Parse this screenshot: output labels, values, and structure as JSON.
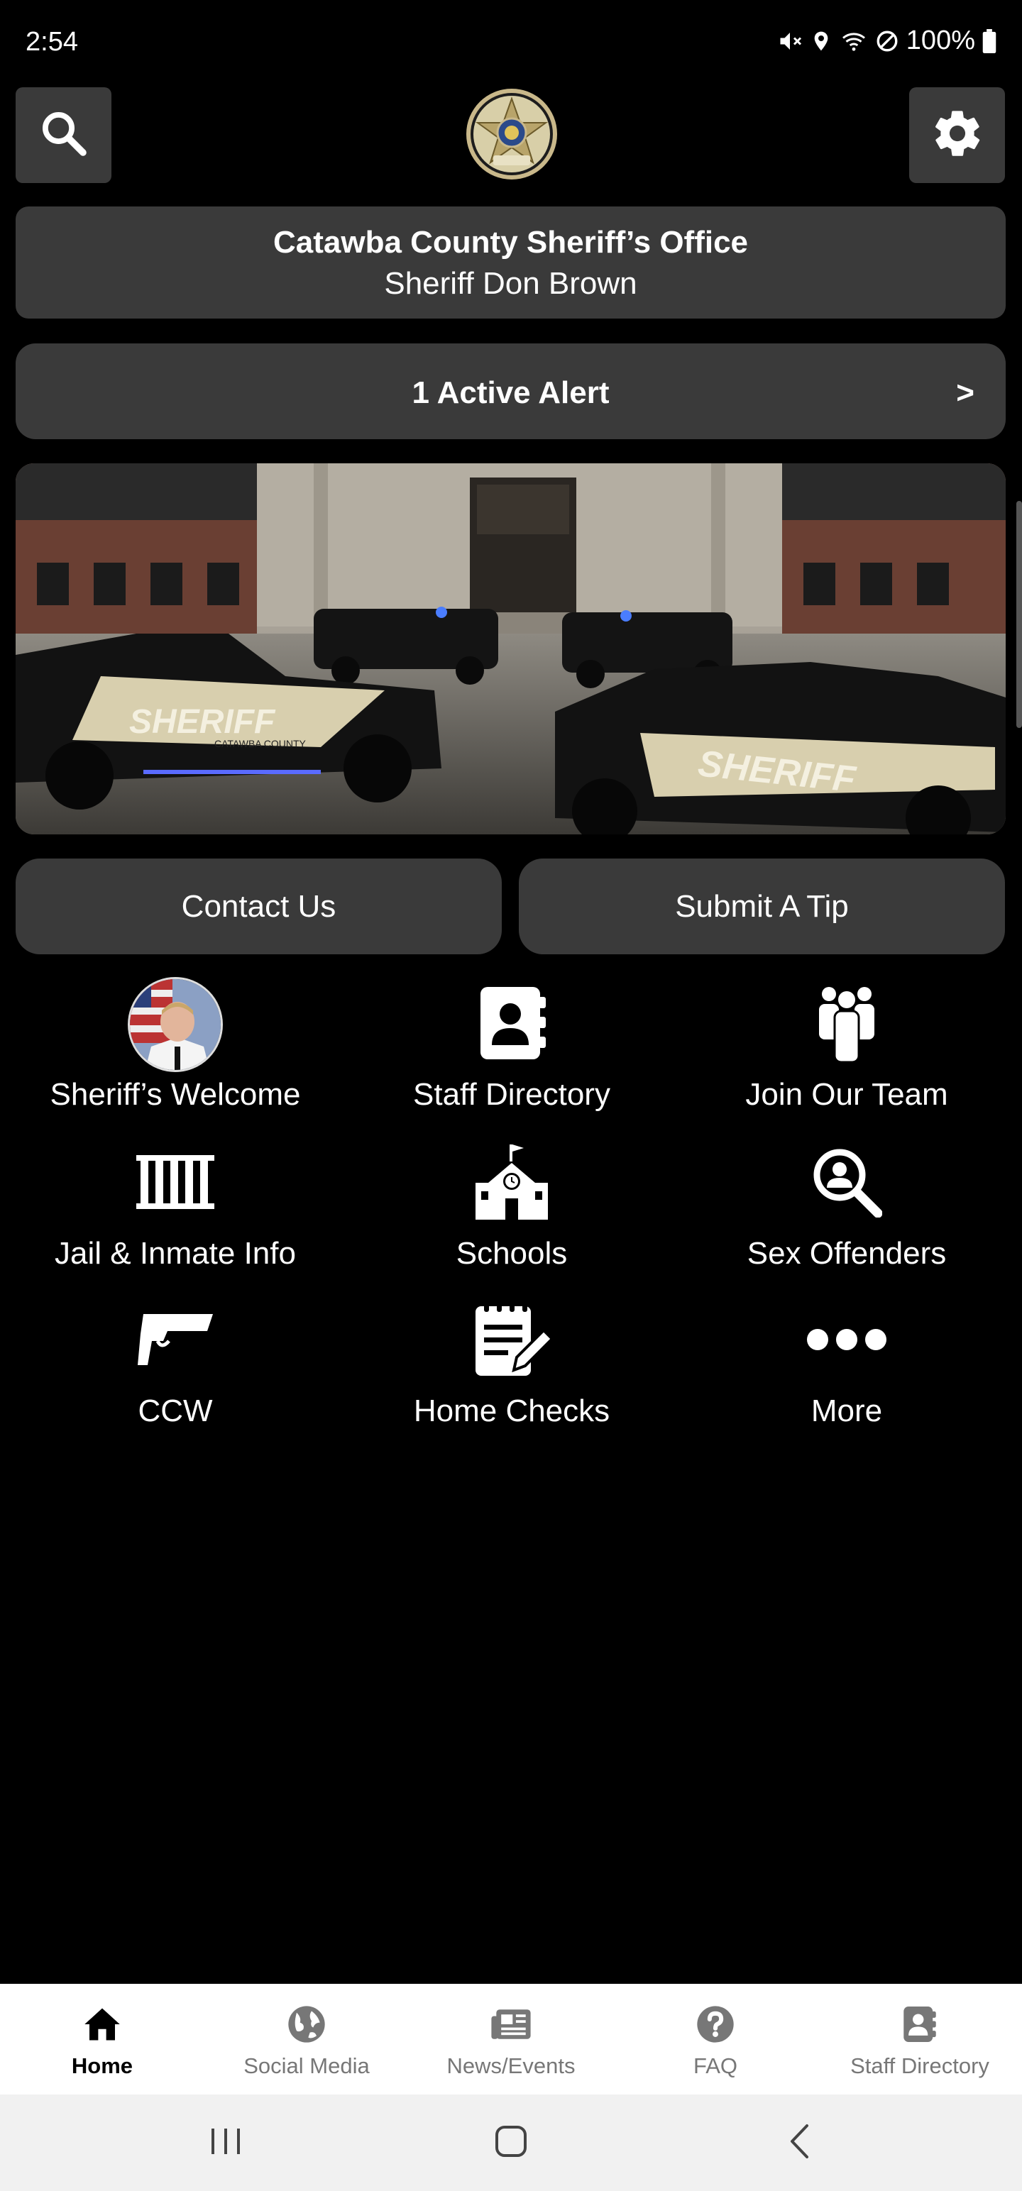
{
  "status_bar": {
    "time": "2:54",
    "battery": "100%"
  },
  "header": {
    "org_name": "Catawba County Sheriff’s Office",
    "sheriff_name": "Sheriff Don Brown",
    "logo_lines": [
      "CATAWBA COUNTY SHERIFF'S",
      "OFFICE"
    ]
  },
  "alert": {
    "label": "1 Active Alert",
    "arrow": ">"
  },
  "hero": {
    "vehicle_text": [
      "SHERIFF",
      "SHERIFF",
      "CATAWBA COUNTY"
    ]
  },
  "actions": {
    "contact": "Contact Us",
    "tip": "Submit A Tip"
  },
  "grid": [
    {
      "label": "Sheriff’s Welcome",
      "icon": "sheriff-photo"
    },
    {
      "label": "Staff Directory",
      "icon": "contact-book-icon"
    },
    {
      "label": "Join Our Team",
      "icon": "people-group-icon"
    },
    {
      "label": "Jail & Inmate Info",
      "icon": "jail-bars-icon"
    },
    {
      "label": "Schools",
      "icon": "school-icon"
    },
    {
      "label": "Sex Offenders",
      "icon": "search-person-icon"
    },
    {
      "label": "CCW",
      "icon": "handgun-icon"
    },
    {
      "label": "Home Checks",
      "icon": "clipboard-edit-icon"
    },
    {
      "label": "More",
      "icon": "more-dots-icon"
    }
  ],
  "bottom_nav": [
    {
      "label": "Home",
      "icon": "home-icon",
      "active": true
    },
    {
      "label": "Social Media",
      "icon": "globe-icon",
      "active": false
    },
    {
      "label": "News/Events",
      "icon": "newspaper-icon",
      "active": false
    },
    {
      "label": "FAQ",
      "icon": "question-icon",
      "active": false
    },
    {
      "label": "Staff Directory",
      "icon": "contact-book-icon",
      "active": false
    }
  ],
  "colors": {
    "background": "#000000",
    "card": "#3a3a3a",
    "nav_bg": "#ffffff",
    "nav_inactive": "#777777"
  }
}
